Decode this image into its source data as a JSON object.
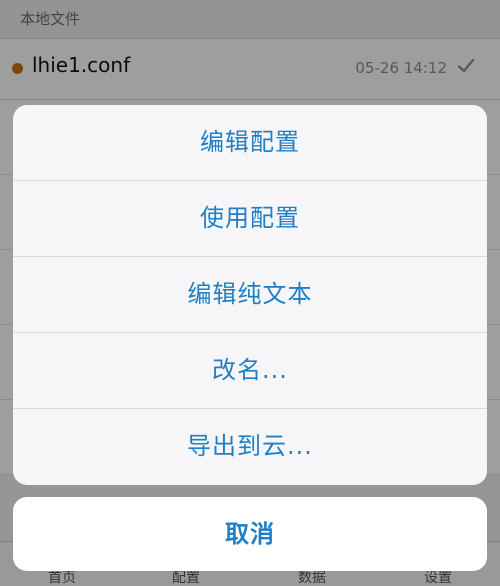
{
  "section_header": "本地文件",
  "file": {
    "name": "lhie1.conf",
    "time": "05-26 14:12",
    "status_color": "#c9750e",
    "check_icon": "checkmark-icon"
  },
  "action_sheet": {
    "items": [
      {
        "label": "编辑配置"
      },
      {
        "label": "使用配置"
      },
      {
        "label": "编辑纯文本"
      },
      {
        "label": "改名..."
      },
      {
        "label": "导出到云..."
      }
    ],
    "cancel_label": "取消",
    "accent_color": "#1f7fc4"
  },
  "tab_bar": {
    "items": [
      {
        "label": "首页"
      },
      {
        "label": "配置"
      },
      {
        "label": "数据"
      },
      {
        "label": "设置"
      }
    ]
  }
}
